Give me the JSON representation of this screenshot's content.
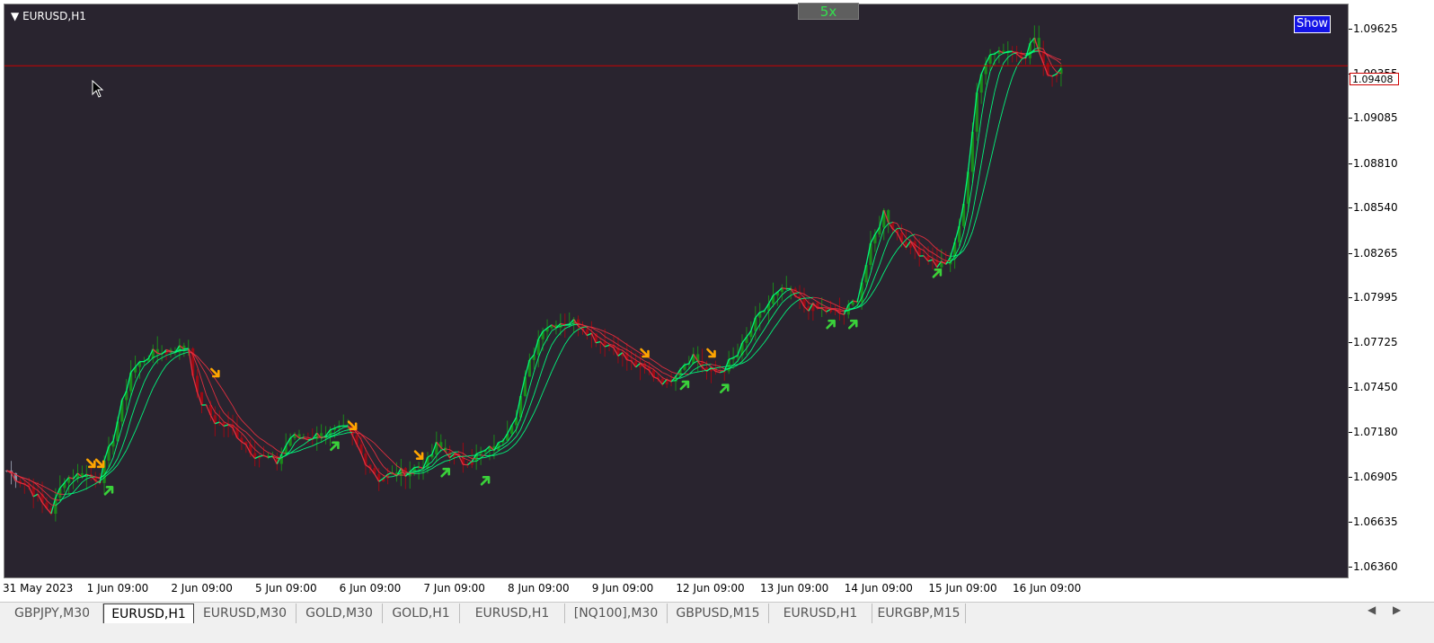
{
  "window": {
    "symbol_label": "EURUSD,H1",
    "zoom_label": "5x",
    "show_label": "Show"
  },
  "price": {
    "current_label": "1.09408",
    "line_value": 1.09408,
    "line_color": "#cc0000"
  },
  "colors": {
    "background": "#29242f",
    "bull": "#1a8a1a",
    "bear": "#9a0a14",
    "neutral": "#8a8fa0",
    "ribbon_up": "#00ff80",
    "ribbon_down": "#e83040",
    "arrow_up": "#3ad13a",
    "arrow_down": "#ffa500"
  },
  "tabs": [
    "GBPJPY,M30",
    "EURUSD,H1",
    "EURUSD,M30",
    "GOLD,M30",
    "GOLD,H1",
    "EURUSD,H1",
    "[NQ100],M30",
    "GBPUSD,M15",
    "EURUSD,H1",
    "EURGBP,M15"
  ],
  "active_tab": 1,
  "chart_data": {
    "type": "candlestick",
    "symbol": "EURUSD",
    "timeframe": "H1",
    "yticks": [
      "1.09625",
      "1.09355",
      "1.09085",
      "1.08810",
      "1.08540",
      "1.08265",
      "1.07995",
      "1.07725",
      "1.07450",
      "1.07180",
      "1.06905",
      "1.06635",
      "1.06360"
    ],
    "ylim": [
      1.063,
      1.0978
    ],
    "xticks": [
      "31 May 2023",
      "1 Jun 09:00",
      "2 Jun 09:00",
      "5 Jun 09:00",
      "6 Jun 09:00",
      "7 Jun 09:00",
      "8 Jun 09:00",
      "9 Jun 09:00",
      "12 Jun 09:00",
      "13 Jun 09:00",
      "14 Jun 09:00",
      "15 Jun 09:00",
      "16 Jun 09:00"
    ],
    "x_tick_bar_index": [
      0,
      19,
      38,
      57,
      76,
      95,
      114,
      133,
      152,
      171,
      190,
      209,
      228
    ],
    "total_bars": 270,
    "close_path": [
      [
        0,
        1.0695
      ],
      [
        5,
        1.0685
      ],
      [
        8,
        1.0675
      ],
      [
        10,
        1.067
      ],
      [
        13,
        1.069
      ],
      [
        17,
        1.0693
      ],
      [
        21,
        1.069
      ],
      [
        24,
        1.0715
      ],
      [
        28,
        1.0755
      ],
      [
        32,
        1.0765
      ],
      [
        36,
        1.0768
      ],
      [
        41,
        1.077
      ],
      [
        43,
        1.074
      ],
      [
        47,
        1.0725
      ],
      [
        51,
        1.072
      ],
      [
        56,
        1.0705
      ],
      [
        61,
        1.07
      ],
      [
        64,
        1.0715
      ],
      [
        68,
        1.0715
      ],
      [
        73,
        1.0718
      ],
      [
        77,
        1.072
      ],
      [
        80,
        1.0705
      ],
      [
        84,
        1.069
      ],
      [
        88,
        1.0693
      ],
      [
        91,
        1.0695
      ],
      [
        95,
        1.07
      ],
      [
        97,
        1.071
      ],
      [
        100,
        1.0705
      ],
      [
        103,
        1.07
      ],
      [
        107,
        1.0705
      ],
      [
        111,
        1.071
      ],
      [
        115,
        1.073
      ],
      [
        118,
        1.076
      ],
      [
        121,
        1.0782
      ],
      [
        125,
        1.0785
      ],
      [
        129,
        1.0785
      ],
      [
        133,
        1.0775
      ],
      [
        137,
        1.077
      ],
      [
        141,
        1.076
      ],
      [
        145,
        1.0755
      ],
      [
        149,
        1.0748
      ],
      [
        152,
        1.0758
      ],
      [
        155,
        1.0765
      ],
      [
        158,
        1.0755
      ],
      [
        161,
        1.0755
      ],
      [
        165,
        1.0765
      ],
      [
        169,
        1.0785
      ],
      [
        173,
        1.08
      ],
      [
        176,
        1.0805
      ],
      [
        180,
        1.0795
      ],
      [
        185,
        1.0792
      ],
      [
        189,
        1.079
      ],
      [
        192,
        1.08
      ],
      [
        195,
        1.083
      ],
      [
        198,
        1.0852
      ],
      [
        202,
        1.0835
      ],
      [
        206,
        1.0828
      ],
      [
        210,
        1.082
      ],
      [
        213,
        1.0822
      ],
      [
        216,
        1.0855
      ],
      [
        219,
        1.0925
      ],
      [
        222,
        1.095
      ],
      [
        226,
        1.095
      ],
      [
        230,
        1.0948
      ],
      [
        232,
        1.0958
      ],
      [
        234,
        1.094
      ],
      [
        236,
        1.0935
      ],
      [
        238,
        1.094
      ]
    ],
    "ribbon_offsets": [
      0.0,
      0.0007,
      0.0014,
      0.0021
    ],
    "ribbon_lags": [
      0,
      3,
      6,
      10
    ],
    "signals": [
      {
        "bar": 19,
        "dir": "down",
        "price": 1.0695
      },
      {
        "bar": 21,
        "dir": "down",
        "price": 1.0695
      },
      {
        "bar": 23,
        "dir": "up",
        "price": 1.0686
      },
      {
        "bar": 47,
        "dir": "down",
        "price": 1.075
      },
      {
        "bar": 74,
        "dir": "up",
        "price": 1.0713
      },
      {
        "bar": 78,
        "dir": "down",
        "price": 1.0718
      },
      {
        "bar": 93,
        "dir": "down",
        "price": 1.07
      },
      {
        "bar": 99,
        "dir": "up",
        "price": 1.0697
      },
      {
        "bar": 108,
        "dir": "up",
        "price": 1.0692
      },
      {
        "bar": 144,
        "dir": "down",
        "price": 1.0762
      },
      {
        "bar": 153,
        "dir": "up",
        "price": 1.075
      },
      {
        "bar": 159,
        "dir": "down",
        "price": 1.0762
      },
      {
        "bar": 162,
        "dir": "up",
        "price": 1.0748
      },
      {
        "bar": 186,
        "dir": "up",
        "price": 1.0787
      },
      {
        "bar": 191,
        "dir": "up",
        "price": 1.0787
      },
      {
        "bar": 210,
        "dir": "up",
        "price": 1.0818
      }
    ]
  }
}
